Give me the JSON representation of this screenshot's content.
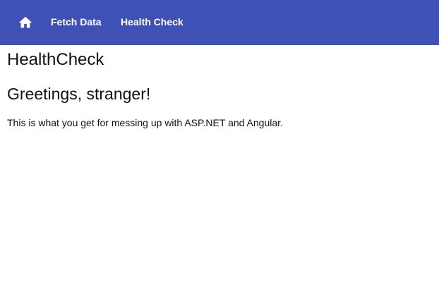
{
  "navbar": {
    "home_icon": "home-icon",
    "background": "#3f51b5",
    "links": [
      {
        "label": "Fetch Data"
      },
      {
        "label": "Health Check"
      }
    ]
  },
  "main": {
    "title": "HealthCheck",
    "greeting": "Greetings, stranger!",
    "description": "This is what you get for messing up with ASP.NET and Angular."
  }
}
